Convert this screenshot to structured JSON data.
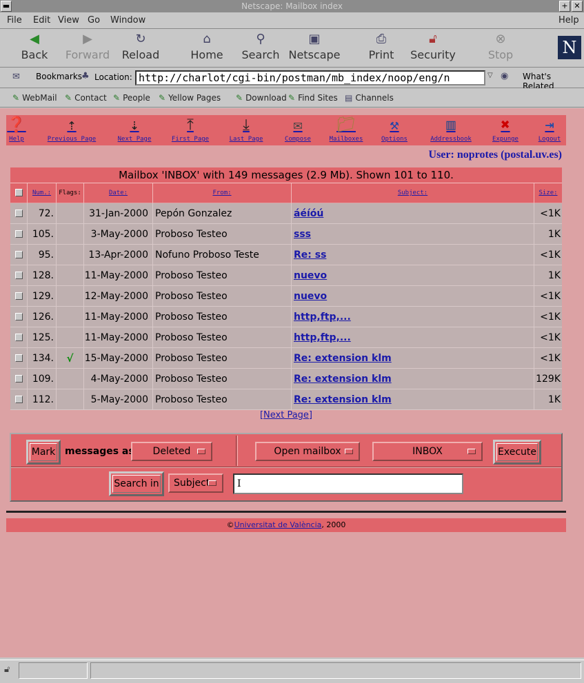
{
  "window": {
    "title": "Netscape: Mailbox index"
  },
  "menu": {
    "file": "File",
    "edit": "Edit",
    "view": "View",
    "go": "Go",
    "window": "Window",
    "help": "Help"
  },
  "nav": {
    "back": "Back",
    "forward": "Forward",
    "reload": "Reload",
    "home": "Home",
    "search": "Search",
    "netscape": "Netscape",
    "print": "Print",
    "security": "Security",
    "stop": "Stop"
  },
  "location": {
    "bookmarks": "Bookmarks",
    "label": "Location:",
    "url": "http://charlot/cgi-bin/postman/mb_index/noop/eng/n",
    "related": "What's Related"
  },
  "personal": {
    "webmail": "WebMail",
    "contact": "Contact",
    "people": "People",
    "yellow": "Yellow Pages",
    "download": "Download",
    "findsites": "Find Sites",
    "channels": "Channels"
  },
  "tools": {
    "help": "Help",
    "previous": "Previous Page",
    "next": "Next Page",
    "first": "First Page",
    "last": "Last Page",
    "compose": "Compose",
    "mailboxes": "Mailboxes",
    "options": "Options",
    "addressbook": "Addressbook",
    "expunge": "Expunge",
    "logout": "Logout"
  },
  "user": "User: noprotes (postal.uv.es)",
  "mailbox": {
    "heading": "Mailbox 'INBOX' with 149 messages (2.9 Mb). Shown 101 to 110."
  },
  "columns": {
    "num": "Num.:",
    "flags": "Flags:",
    "date": "Date:",
    "from": "From:",
    "subject": "Subject:",
    "size": "Size:"
  },
  "messages": [
    {
      "num": "72.",
      "flag": "",
      "date": "31-Jan-2000",
      "from": "Pepón Gonzalez",
      "subject": "áéíóú",
      "size": "<1K"
    },
    {
      "num": "105.",
      "flag": "",
      "date": "3-May-2000",
      "from": "Proboso Testeo",
      "subject": "sss",
      "size": "1K"
    },
    {
      "num": "95.",
      "flag": "",
      "date": "13-Apr-2000",
      "from": "Nofuno Proboso Teste",
      "subject": "Re: ss",
      "size": "<1K"
    },
    {
      "num": "128.",
      "flag": "",
      "date": "11-May-2000",
      "from": "Proboso Testeo",
      "subject": "nuevo",
      "size": "1K"
    },
    {
      "num": "129.",
      "flag": "",
      "date": "12-May-2000",
      "from": "Proboso Testeo",
      "subject": "nuevo",
      "size": "<1K"
    },
    {
      "num": "126.",
      "flag": "",
      "date": "11-May-2000",
      "from": "Proboso Testeo",
      "subject": "http,ftp,...",
      "size": "<1K"
    },
    {
      "num": "125.",
      "flag": "",
      "date": "11-May-2000",
      "from": "Proboso Testeo",
      "subject": "http,ftp,...",
      "size": "<1K"
    },
    {
      "num": "134.",
      "flag": "√",
      "date": "15-May-2000",
      "from": "Proboso Testeo",
      "subject": "Re: extension klm",
      "size": "<1K"
    },
    {
      "num": "109.",
      "flag": "",
      "date": "4-May-2000",
      "from": "Proboso Testeo",
      "subject": "Re: extension klm",
      "size": "129K"
    },
    {
      "num": "112.",
      "flag": "",
      "date": "5-May-2000",
      "from": "Proboso Testeo",
      "subject": "Re: extension klm",
      "size": "1K"
    }
  ],
  "pager": {
    "next": "[Next Page]"
  },
  "controls": {
    "mark": "Mark",
    "messages_as": "messages as",
    "mark_value": "Deleted",
    "action_value": "Open mailbox",
    "mailbox_value": "INBOX",
    "execute": "Execute",
    "search_in": "Search in",
    "search_field": "Subject",
    "search_text": ""
  },
  "footer": {
    "copy": "©",
    "university": "Universitat de València",
    "year": ", 2000"
  }
}
